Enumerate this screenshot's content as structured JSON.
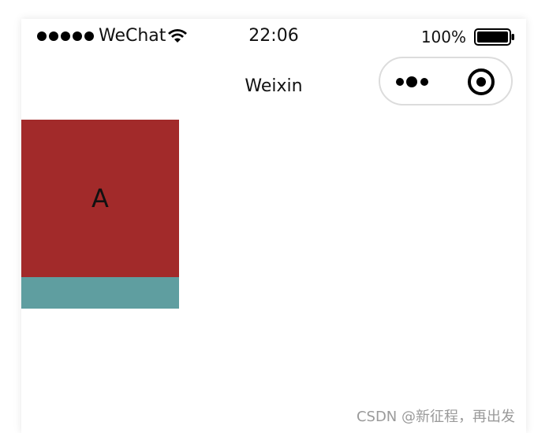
{
  "status_bar": {
    "carrier": "WeChat",
    "time": "22:06",
    "battery": "100%"
  },
  "nav": {
    "title": "Weixin"
  },
  "content": {
    "block_a_label": "A",
    "block_a_color": "#a22a2a",
    "block_b_color": "#5f9ea0"
  },
  "icons": {
    "signal": "signal-dots-icon",
    "wifi": "wifi-icon",
    "battery": "battery-icon",
    "more": "more-icon",
    "close_target": "target-icon"
  },
  "watermark": "CSDN @新征程，再出发"
}
